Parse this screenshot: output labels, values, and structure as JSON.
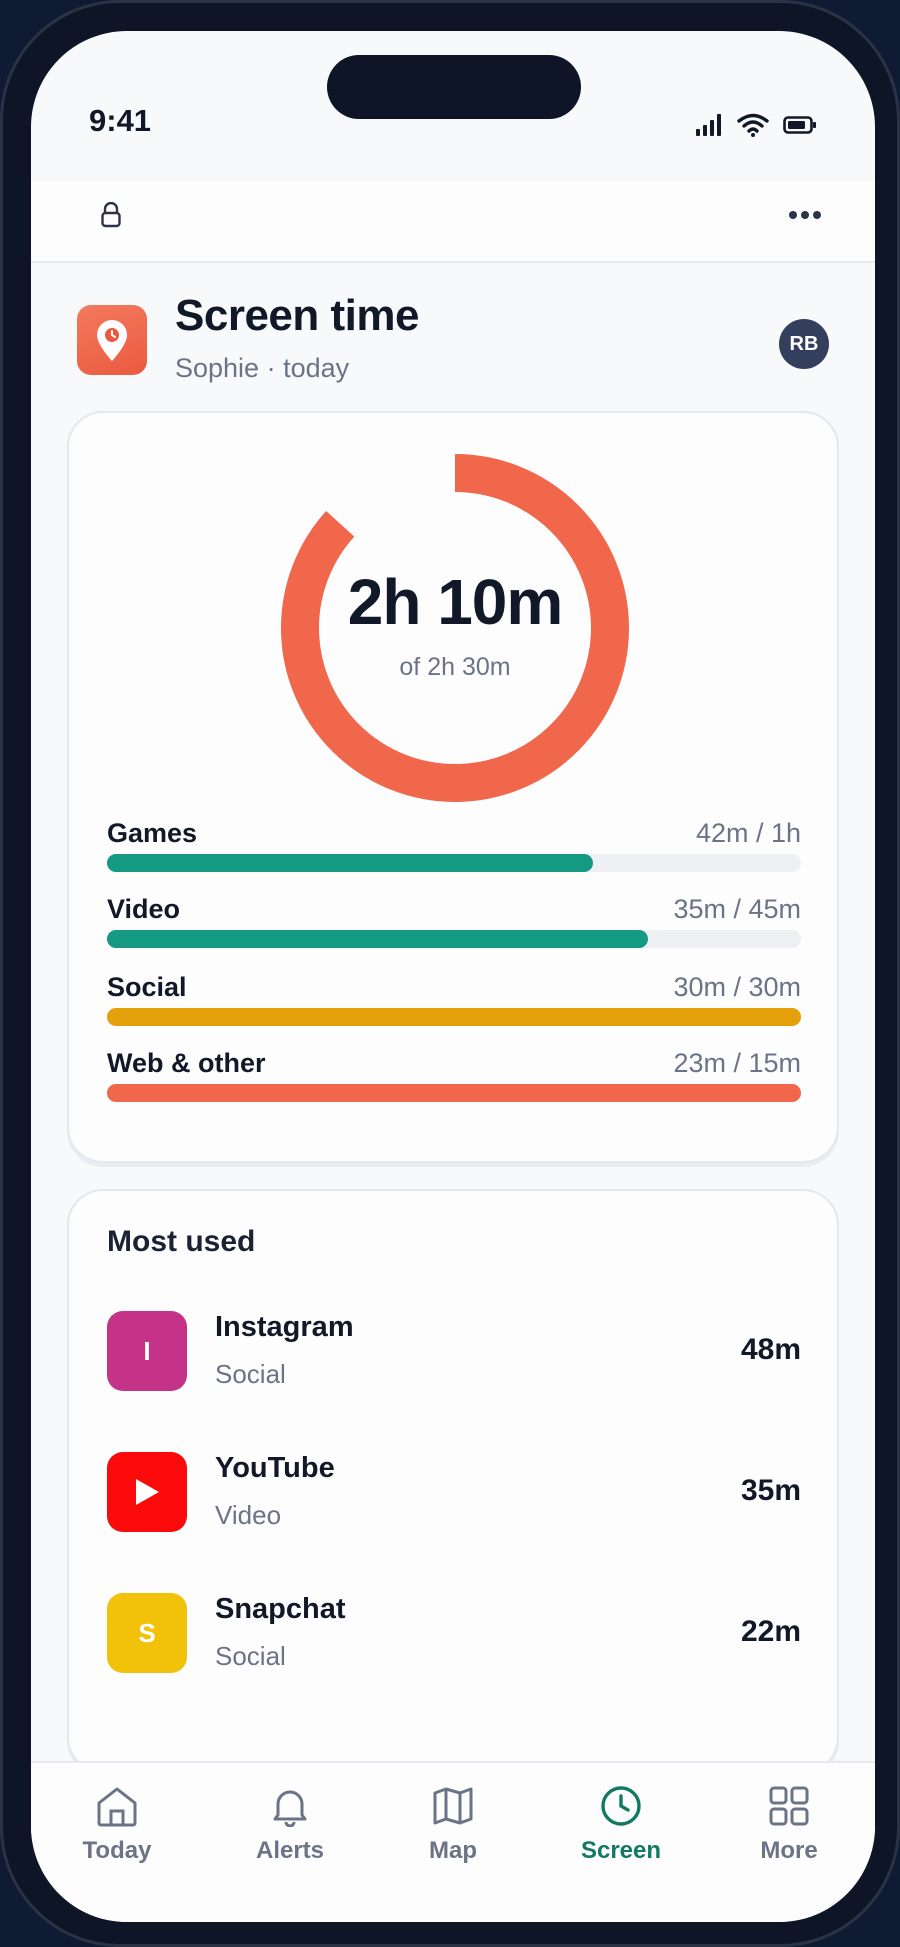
{
  "status_bar": {
    "time": "9:41"
  },
  "header": {
    "title": "Screen time",
    "subtitle": "Sophie · today",
    "avatar_initials": "RB",
    "app_icon": "location-pin-icon"
  },
  "summary": {
    "used": "2h 10m",
    "limit_label": "of 2h 30m",
    "progress": 0.867,
    "ring_color": "#f0674c",
    "categories": [
      {
        "name": "Games",
        "usage": "42m / 1h",
        "progress": 0.7,
        "color": "#149a83"
      },
      {
        "name": "Video",
        "usage": "35m / 45m",
        "progress": 0.78,
        "color": "#149a83"
      },
      {
        "name": "Social",
        "usage": "30m / 30m",
        "progress": 1.0,
        "color": "#e5a10b"
      },
      {
        "name": "Web & other",
        "usage": "23m / 15m",
        "progress": 1.0,
        "color": "#f0674c"
      }
    ]
  },
  "most_used": {
    "title": "Most used",
    "apps": [
      {
        "name": "Instagram",
        "category": "Social",
        "time": "48m",
        "icon_letter": "I",
        "color": "#c43388"
      },
      {
        "name": "YouTube",
        "category": "Video",
        "time": "35m",
        "icon_letter": "",
        "icon": "play-icon",
        "color": "#fa0a0a"
      },
      {
        "name": "Snapchat",
        "category": "Social",
        "time": "22m",
        "icon_letter": "S",
        "color": "#f2c20a"
      }
    ]
  },
  "tabs": [
    {
      "label": "Today",
      "icon": "home-icon",
      "active": false
    },
    {
      "label": "Alerts",
      "icon": "bell-icon",
      "active": false
    },
    {
      "label": "Map",
      "icon": "map-icon",
      "active": false
    },
    {
      "label": "Screen",
      "icon": "clock-icon",
      "active": true
    },
    {
      "label": "More",
      "icon": "grid-icon",
      "active": false
    }
  ],
  "colors": {
    "accent": "#127a63",
    "brand": "#f0674c"
  }
}
